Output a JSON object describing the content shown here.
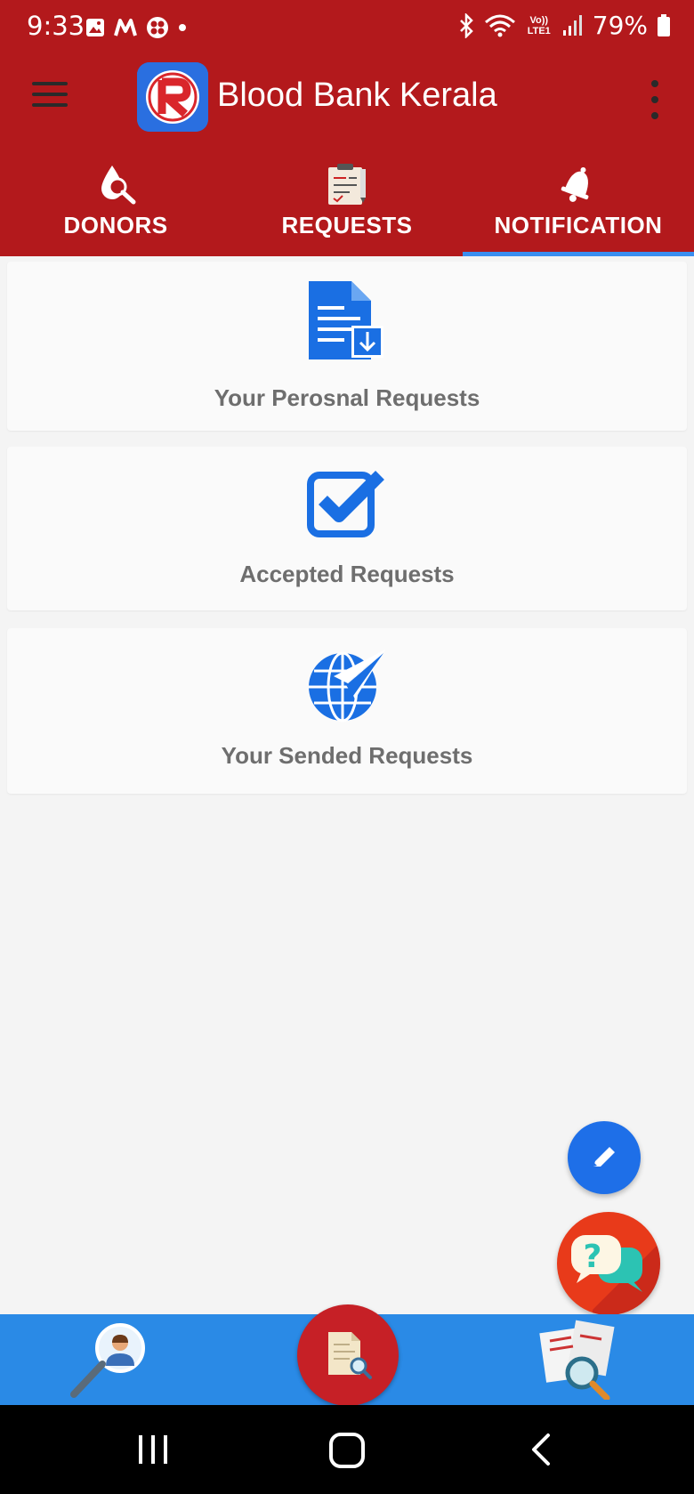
{
  "status_bar": {
    "time": "9:33",
    "battery": "79%",
    "network_label": "Vo)) LTE1",
    "left_icons": [
      "image-icon",
      "m-app-icon",
      "flower-app-icon",
      "dot-icon"
    ],
    "right_icons": [
      "bluetooth-icon",
      "wifi-icon",
      "volte-icon",
      "signal-icon",
      "battery-icon"
    ]
  },
  "app_bar": {
    "title": "Blood Bank Kerala",
    "menu_icon": "hamburger-menu-icon",
    "overflow_icon": "more-vert-icon"
  },
  "tabs": [
    {
      "label": "DONORS",
      "icon": "blood-drop-search-icon",
      "active": false
    },
    {
      "label": "REQUESTS",
      "icon": "clipboard-icon",
      "active": false
    },
    {
      "label": "NOTIFICATION",
      "icon": "bell-icon",
      "active": true
    }
  ],
  "cards": [
    {
      "label": "Your Perosnal Requests",
      "icon": "document-download-icon"
    },
    {
      "label": "Accepted Requests",
      "icon": "checkbox-checked-icon"
    },
    {
      "label": "Your Sended Requests",
      "icon": "globe-paper-plane-icon"
    }
  ],
  "fabs": {
    "edit_icon": "pencil-icon",
    "help_icon": "help-chat-icon",
    "help_glyph": "?"
  },
  "bottom_nav": {
    "left_icon": "user-search-icon",
    "center_icon": "document-search-icon",
    "right_icon": "reports-search-icon"
  },
  "colors": {
    "primary": "#b3191c",
    "accent_blue": "#1e6fe8",
    "bottom_nav": "#2a8ae6",
    "tab_indicator": "#3a8ef0"
  }
}
